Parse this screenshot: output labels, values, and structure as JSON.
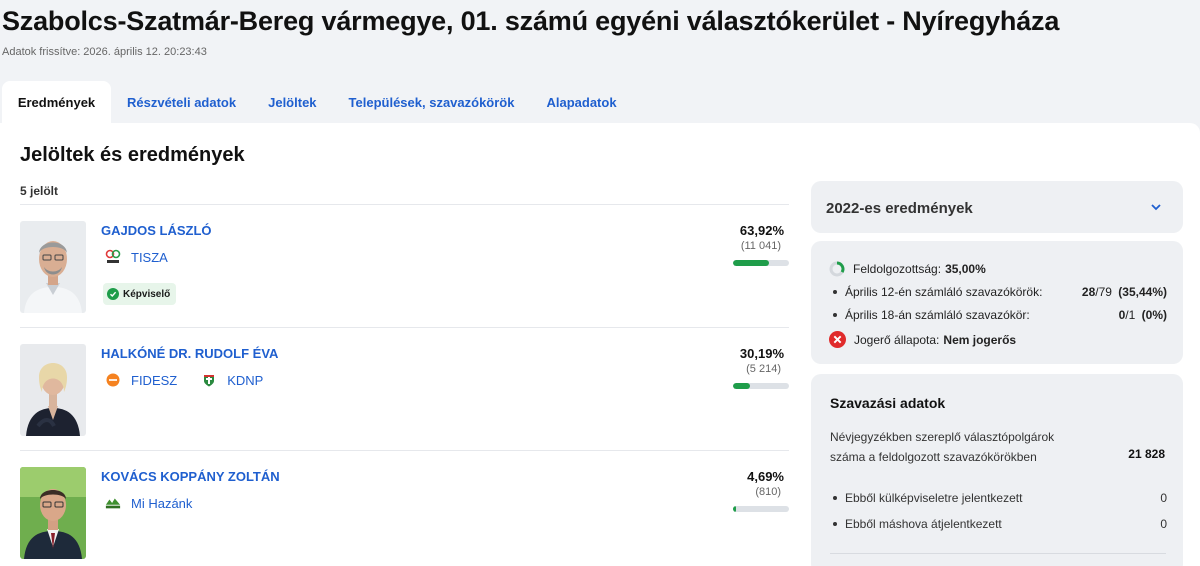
{
  "page": {
    "title": "Szabolcs-Szatmár-Bereg vármegye, 01. számú egyéni választókerület - Nyíregyháza",
    "updated": "Adatok frissítve: 2026. április 12. 20:23:43"
  },
  "tabs": [
    {
      "label": "Eredmények"
    },
    {
      "label": "Részvételi adatok"
    },
    {
      "label": "Jelöltek"
    },
    {
      "label": "Települések, szavazókörök"
    },
    {
      "label": "Alapadatok"
    }
  ],
  "main": {
    "title": "Jelöltek és eredmények",
    "count": "5 jelölt",
    "candidates": [
      {
        "name": "GAJDOS LÁSZLÓ",
        "parties": [
          "TISZA"
        ],
        "badge": "Képviselő",
        "pct": "63,92%",
        "votes": "(11 041)",
        "share": 0.6392
      },
      {
        "name": "HALKÓNÉ DR. RUDOLF ÉVA",
        "parties": [
          "FIDESZ",
          "KDNP"
        ],
        "pct": "30,19%",
        "votes": "(5 214)",
        "share": 0.3019
      },
      {
        "name": "KOVÁCS KOPPÁNY ZOLTÁN",
        "parties": [
          "Mi Hazánk"
        ],
        "pct": "4,69%",
        "votes": "(810)",
        "share": 0.0469
      }
    ]
  },
  "side": {
    "prev_results_label": "2022-es eredmények",
    "processing": {
      "label": "Feldolgozottság:",
      "value": "35,00%",
      "apr12_label": "Április 12-én számláló szavazókörök:",
      "apr12_done": "28",
      "apr12_total": "/79",
      "apr12_pct": "(35,44%)",
      "apr18_label": "Április 18-án számláló szavazókör:",
      "apr18_done": "0",
      "apr18_total": "/1",
      "apr18_pct": "(0%)",
      "legal_label": "Jogerő állapota:",
      "legal_value": "Nem jogerős"
    },
    "voting": {
      "title": "Szavazási adatok",
      "registered_label": "Névjegyzékben szereplő választópolgárok száma a feldolgozott szavazókörökben",
      "registered_value": "21 828",
      "abroad_label": "Ebből külképviseletre jelentkezett",
      "abroad_value": "0",
      "elsewhere_label": "Ebből máshova átjelentkezett",
      "elsewhere_value": "0"
    }
  },
  "colors": {
    "link": "#1f5fcf",
    "bar": "#1f9d4a",
    "fidesz": "#f58220",
    "error": "#e02b2b"
  }
}
